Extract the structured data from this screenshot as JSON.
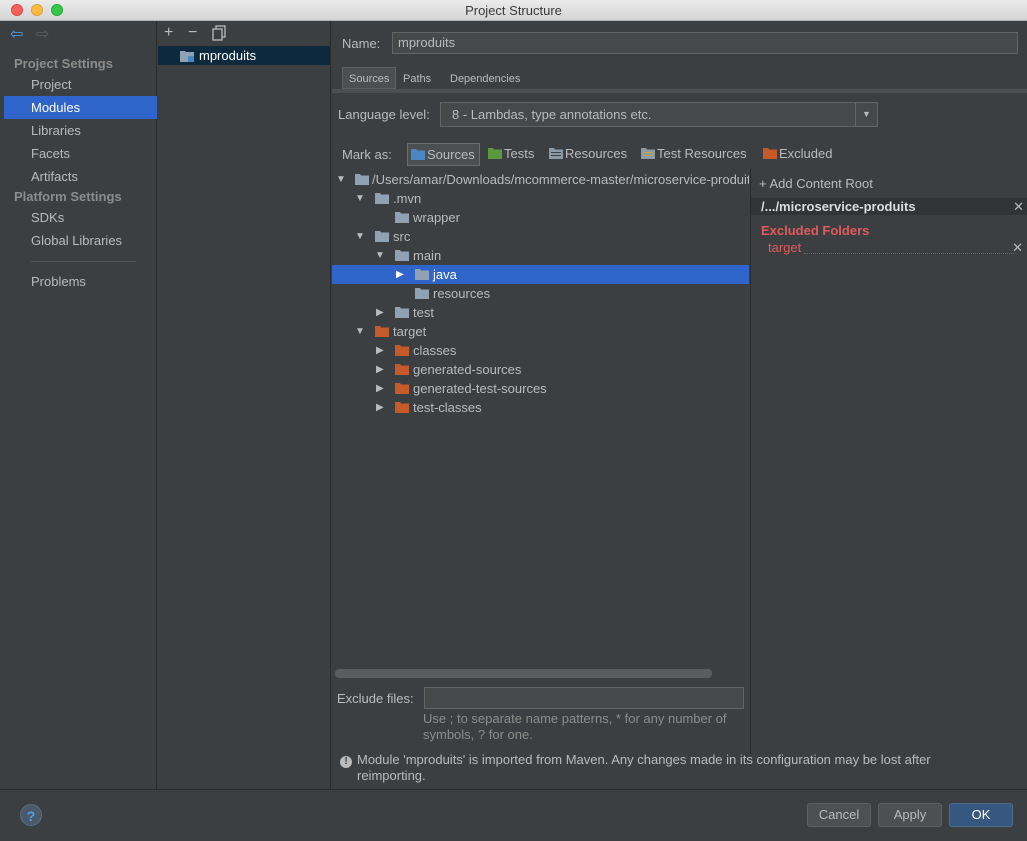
{
  "window": {
    "title": "Project Structure"
  },
  "sidebar": {
    "project_settings_header": "Project Settings",
    "platform_settings_header": "Platform Settings",
    "items": [
      {
        "label": "Project"
      },
      {
        "label": "Modules"
      },
      {
        "label": "Libraries"
      },
      {
        "label": "Facets"
      },
      {
        "label": "Artifacts"
      },
      {
        "label": "SDKs"
      },
      {
        "label": "Global Libraries"
      },
      {
        "label": "Problems"
      }
    ],
    "selected": "Modules"
  },
  "modules": {
    "add": "+",
    "remove": "−",
    "items": [
      {
        "label": "mproduits"
      }
    ]
  },
  "main": {
    "name_label": "Name:",
    "name_value": "mproduits",
    "tabs": [
      {
        "label": "Sources"
      },
      {
        "label": "Paths"
      },
      {
        "label": "Dependencies"
      }
    ],
    "language_level_label": "Language level:",
    "language_level_value": "8 - Lambdas, type annotations etc.",
    "mark_as_label": "Mark as:",
    "mark_as": [
      {
        "label": "Sources",
        "color": "#4a87c2"
      },
      {
        "label": "Tests",
        "color": "#5a9a3d"
      },
      {
        "label": "Resources",
        "color": "#8c9aa8"
      },
      {
        "label": "Test Resources",
        "color": "#8c9aa8"
      },
      {
        "label": "Excluded",
        "color": "#c55a2b"
      }
    ],
    "tree": [
      {
        "label": "/Users/amar/Downloads/mcommerce-master/microservice-produits"
      },
      {
        "label": ".mvn"
      },
      {
        "label": "wrapper"
      },
      {
        "label": "src"
      },
      {
        "label": "main"
      },
      {
        "label": "java"
      },
      {
        "label": "resources"
      },
      {
        "label": "test"
      },
      {
        "label": "target"
      },
      {
        "label": "classes"
      },
      {
        "label": "generated-sources"
      },
      {
        "label": "generated-test-sources"
      },
      {
        "label": "test-classes"
      }
    ],
    "add_content_root": "Add Content Root",
    "content_root": "/.../microservice-produits",
    "excluded_folders_title": "Excluded Folders",
    "excluded_folders": [
      "target"
    ],
    "exclude_files_label": "Exclude files:",
    "exclude_files_value": "",
    "exclude_files_hint": "Use ; to separate name patterns, * for any number of symbols, ? for one.",
    "notice": "Module 'mproduits' is imported from Maven. Any changes made in its configuration may be lost after reimporting."
  },
  "buttons": {
    "help": "?",
    "cancel": "Cancel",
    "apply": "Apply",
    "ok": "OK"
  }
}
